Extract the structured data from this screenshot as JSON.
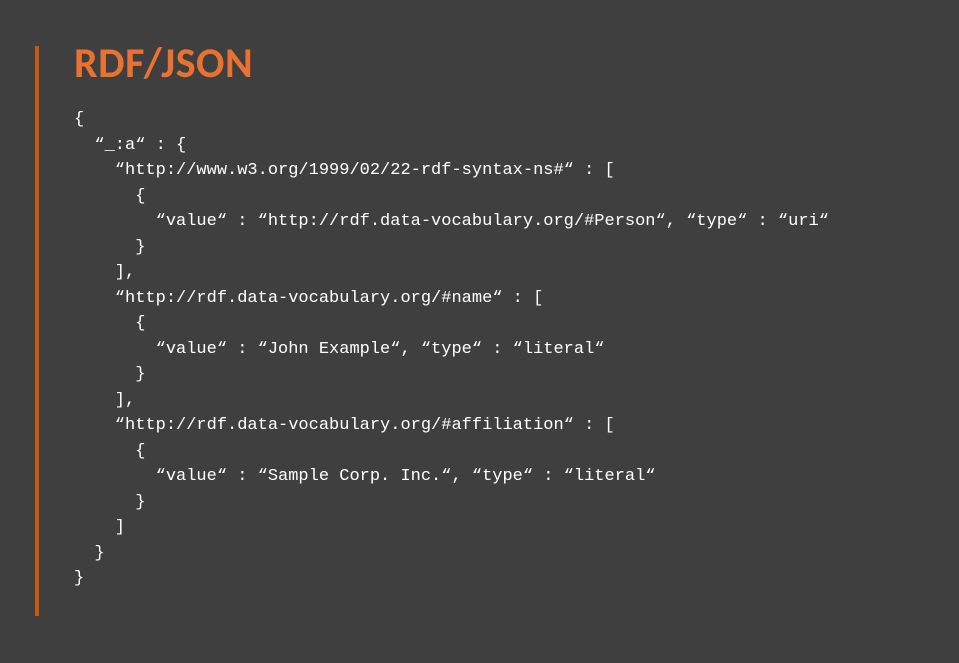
{
  "title": "RDF/JSON",
  "code_lines": [
    "{",
    "  “_:a“ : {",
    "    “http://www.w3.org/1999/02/22-rdf-syntax-ns#“ : [",
    "      {",
    "        “value“ : “http://rdf.data-vocabulary.org/#Person“, “type“ : “uri“",
    "      }",
    "    ],",
    "    “http://rdf.data-vocabulary.org/#name“ : [",
    "      {",
    "        “value“ : “John Example“, “type“ : “literal“",
    "      }",
    "    ],",
    "    “http://rdf.data-vocabulary.org/#affiliation“ : [",
    "      {",
    "        “value“ : “Sample Corp. Inc.“, “type“ : “literal“",
    "      }",
    "    ]",
    "  }",
    "}"
  ]
}
